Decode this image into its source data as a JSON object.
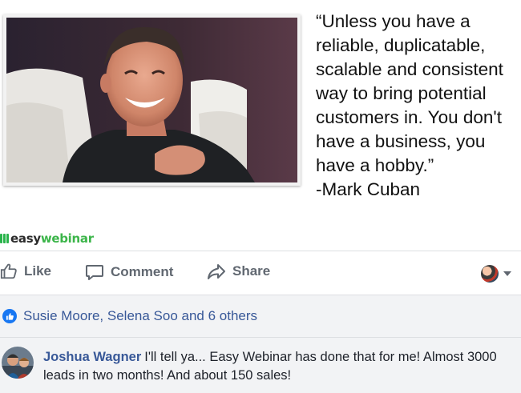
{
  "quote": {
    "text": "“Unless you have a\nreliable, duplicatable,\nscalable and consistent\nway to bring potential\ncustomers in. You don't\nhave a business, you\nhave a hobby.”\n-Mark Cuban"
  },
  "brand": {
    "part1": "easy",
    "part2": "webinar",
    "color": "#3cb54a"
  },
  "actions": {
    "like": "Like",
    "comment": "Comment",
    "share": "Share"
  },
  "reactions": {
    "summary": "Susie Moore, Selena Soo and 6 others",
    "icon": "thumbs-up-icon",
    "accent": "#1877f2"
  },
  "comment": {
    "author": "Joshua Wagner",
    "text": "I'll tell ya... Easy Webinar has done that for me! Almost 3000 leads in two months! And about 150 sales!"
  },
  "colors": {
    "link": "#385898",
    "muted": "#606770",
    "panel": "#f2f3f5"
  }
}
